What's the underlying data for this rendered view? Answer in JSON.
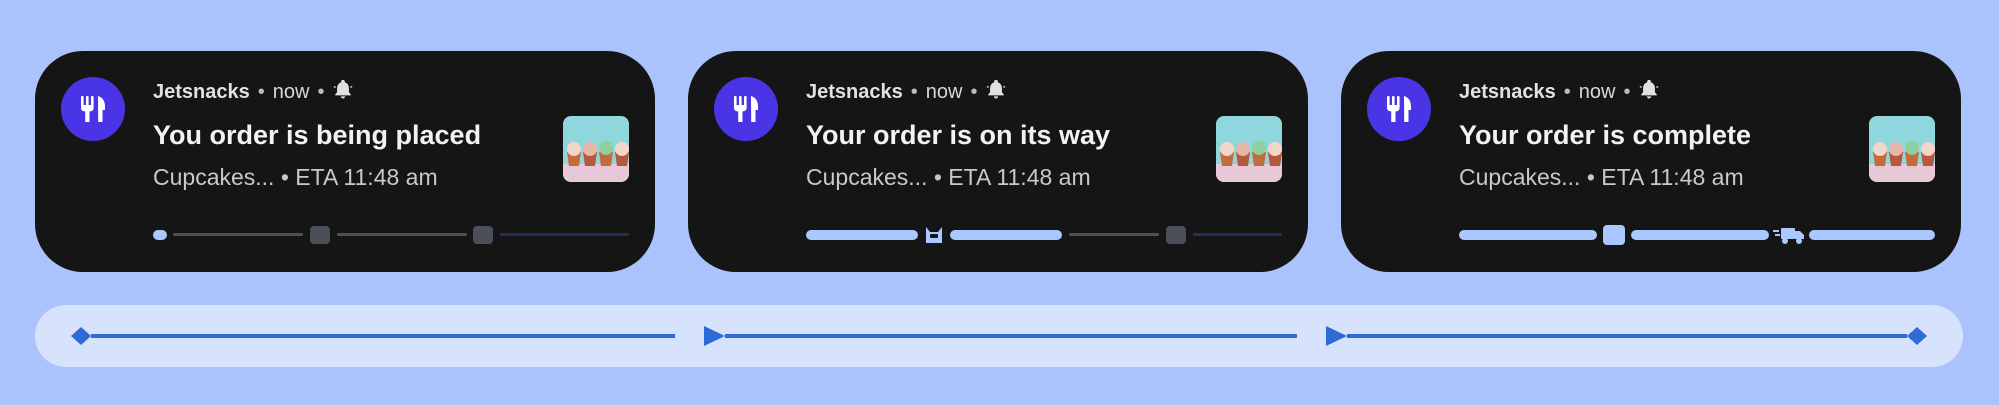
{
  "notifications": [
    {
      "app_name": "Jetsnacks",
      "time": "now",
      "title": "You order is being placed",
      "subtitle": "Cupcakes... • ETA 11:48 am",
      "progress": {
        "completed_segments": 0,
        "current_icon": "none"
      }
    },
    {
      "app_name": "Jetsnacks",
      "time": "now",
      "title": "Your order is on its way",
      "subtitle": "Cupcakes... • ETA 11:48 am",
      "progress": {
        "completed_segments": 1,
        "current_icon": "robot-icon"
      }
    },
    {
      "app_name": "Jetsnacks",
      "time": "now",
      "title": "Your order is complete",
      "subtitle": "Cupcakes... • ETA 11:48 am",
      "progress": {
        "completed_segments": 3,
        "current_icon": "delivery-truck-icon"
      }
    }
  ],
  "colors": {
    "background": "#aac3fd",
    "card": "#151515",
    "app_icon": "#4a35e6",
    "progress_done": "#aac8ff",
    "progress_pending": "#4a4f5a",
    "timeline_track": "#d7e2fd",
    "timeline_line": "#2e6bd6"
  },
  "icons": {
    "app": "fork-knife-icon",
    "alert": "bell-icon",
    "thumbnail": "cupcakes-image"
  }
}
